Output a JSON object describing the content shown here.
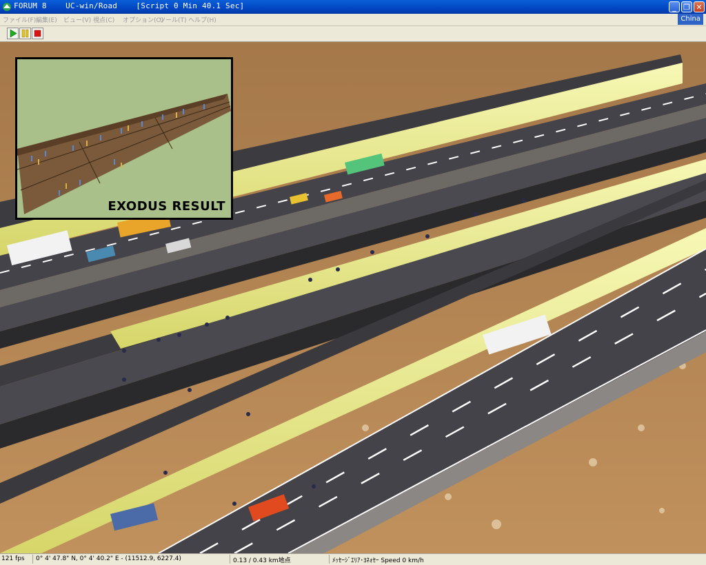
{
  "window": {
    "app_name": "FORUM 8",
    "product": "UC-win/Road",
    "script_time": "[Script 0 Min 40.1 Sec]",
    "region": "China"
  },
  "menu": [
    "ファイル(F)",
    "編集(E)",
    "ビュー(V)",
    "視点(C)",
    "オプション(O)",
    "ツール(T)",
    "ヘルプ(H)"
  ],
  "toolbar": {
    "play": "play-icon",
    "pause": "pause-icon",
    "stop": "stop-icon"
  },
  "inset": {
    "label": "EXODUS RESULT"
  },
  "status": {
    "fps": "121 fps",
    "coordinates": "0° 4' 47.8\" N, 0° 4' 40.2\" E - (11512.9, 6227.4)",
    "distance": "0.13 / 0.43 km地点",
    "info": "ﾒｯｾｰｼﾞｴﾘｱ･ﾖﾈｫｾｰ Speed 0 km/h"
  },
  "colors": {
    "titlebar": "#0246c2",
    "ground": "#b58a55",
    "road": "#45434a",
    "tunnel_wall": "#eef29a",
    "inset_bg": "#a9c08a"
  }
}
